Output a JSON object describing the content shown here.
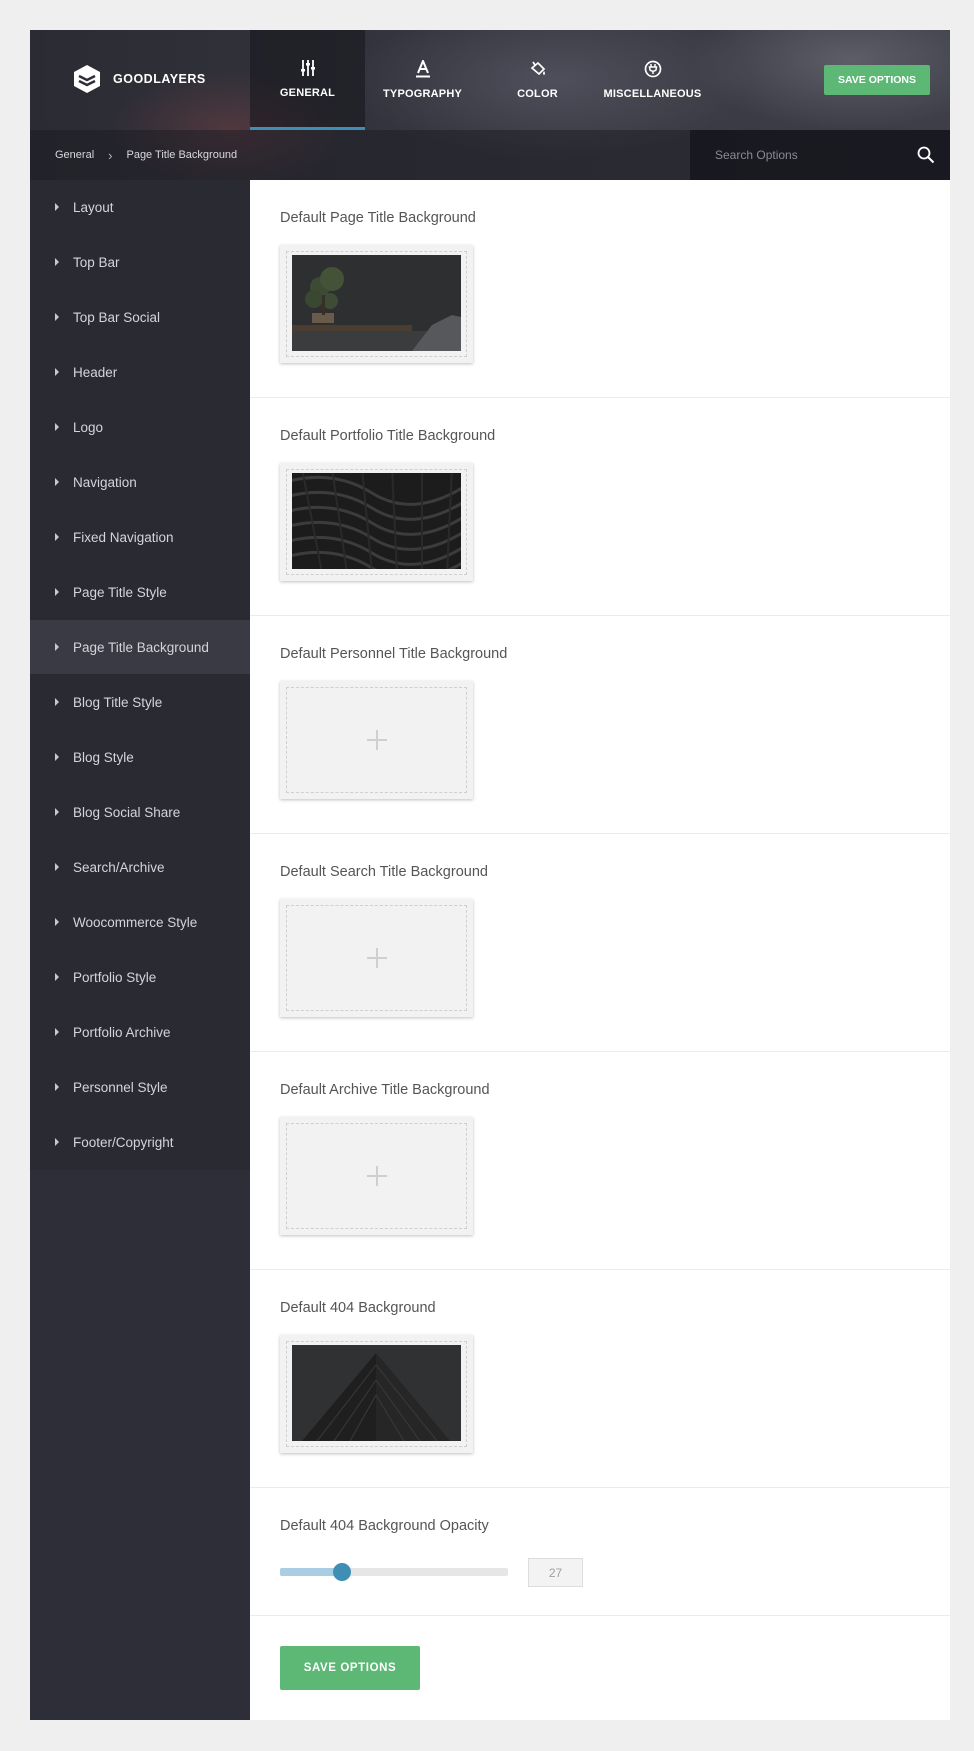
{
  "header": {
    "logo_text": "GOODLAYERS",
    "tabs": [
      {
        "label": "GENERAL",
        "icon": "sliders-icon",
        "active": true
      },
      {
        "label": "TYPOGRAPHY",
        "icon": "typography-icon",
        "active": false
      },
      {
        "label": "COLOR",
        "icon": "paint-bucket-icon",
        "active": false
      },
      {
        "label": "MISCELLANEOUS",
        "icon": "plug-icon",
        "active": false
      }
    ],
    "save_label": "SAVE OPTIONS"
  },
  "breadcrumb": {
    "items": [
      "General",
      "Page Title Background"
    ],
    "separator": "›"
  },
  "search": {
    "placeholder": "Search Options"
  },
  "sidebar": {
    "items": [
      {
        "label": "Layout"
      },
      {
        "label": "Top Bar"
      },
      {
        "label": "Top Bar Social"
      },
      {
        "label": "Header"
      },
      {
        "label": "Logo"
      },
      {
        "label": "Navigation"
      },
      {
        "label": "Fixed Navigation"
      },
      {
        "label": "Page Title Style"
      },
      {
        "label": "Page Title Background",
        "active": true
      },
      {
        "label": "Blog Title Style"
      },
      {
        "label": "Blog Style"
      },
      {
        "label": "Blog Social Share"
      },
      {
        "label": "Search/Archive"
      },
      {
        "label": "Woocommerce Style"
      },
      {
        "label": "Portfolio Style"
      },
      {
        "label": "Portfolio Archive"
      },
      {
        "label": "Personnel Style"
      },
      {
        "label": "Footer/Copyright"
      }
    ]
  },
  "main": {
    "sections": [
      {
        "title": "Default Page Title Background",
        "image": "bonsai-desk-photo"
      },
      {
        "title": "Default Portfolio Title Background",
        "image": "abstract-wave-pattern"
      },
      {
        "title": "Default Personnel Title Background",
        "image": null
      },
      {
        "title": "Default Search Title Background",
        "image": null
      },
      {
        "title": "Default Archive Title Background",
        "image": null
      },
      {
        "title": "Default 404 Background",
        "image": "dark-building-photo"
      }
    ],
    "opacity": {
      "title": "Default 404 Background Opacity",
      "value": "27",
      "fraction": 0.27
    },
    "save_label": "SAVE OPTIONS"
  },
  "colors": {
    "accent": "#3f8fb5",
    "save": "#5cb874",
    "sidebar": "#2e2e38"
  }
}
